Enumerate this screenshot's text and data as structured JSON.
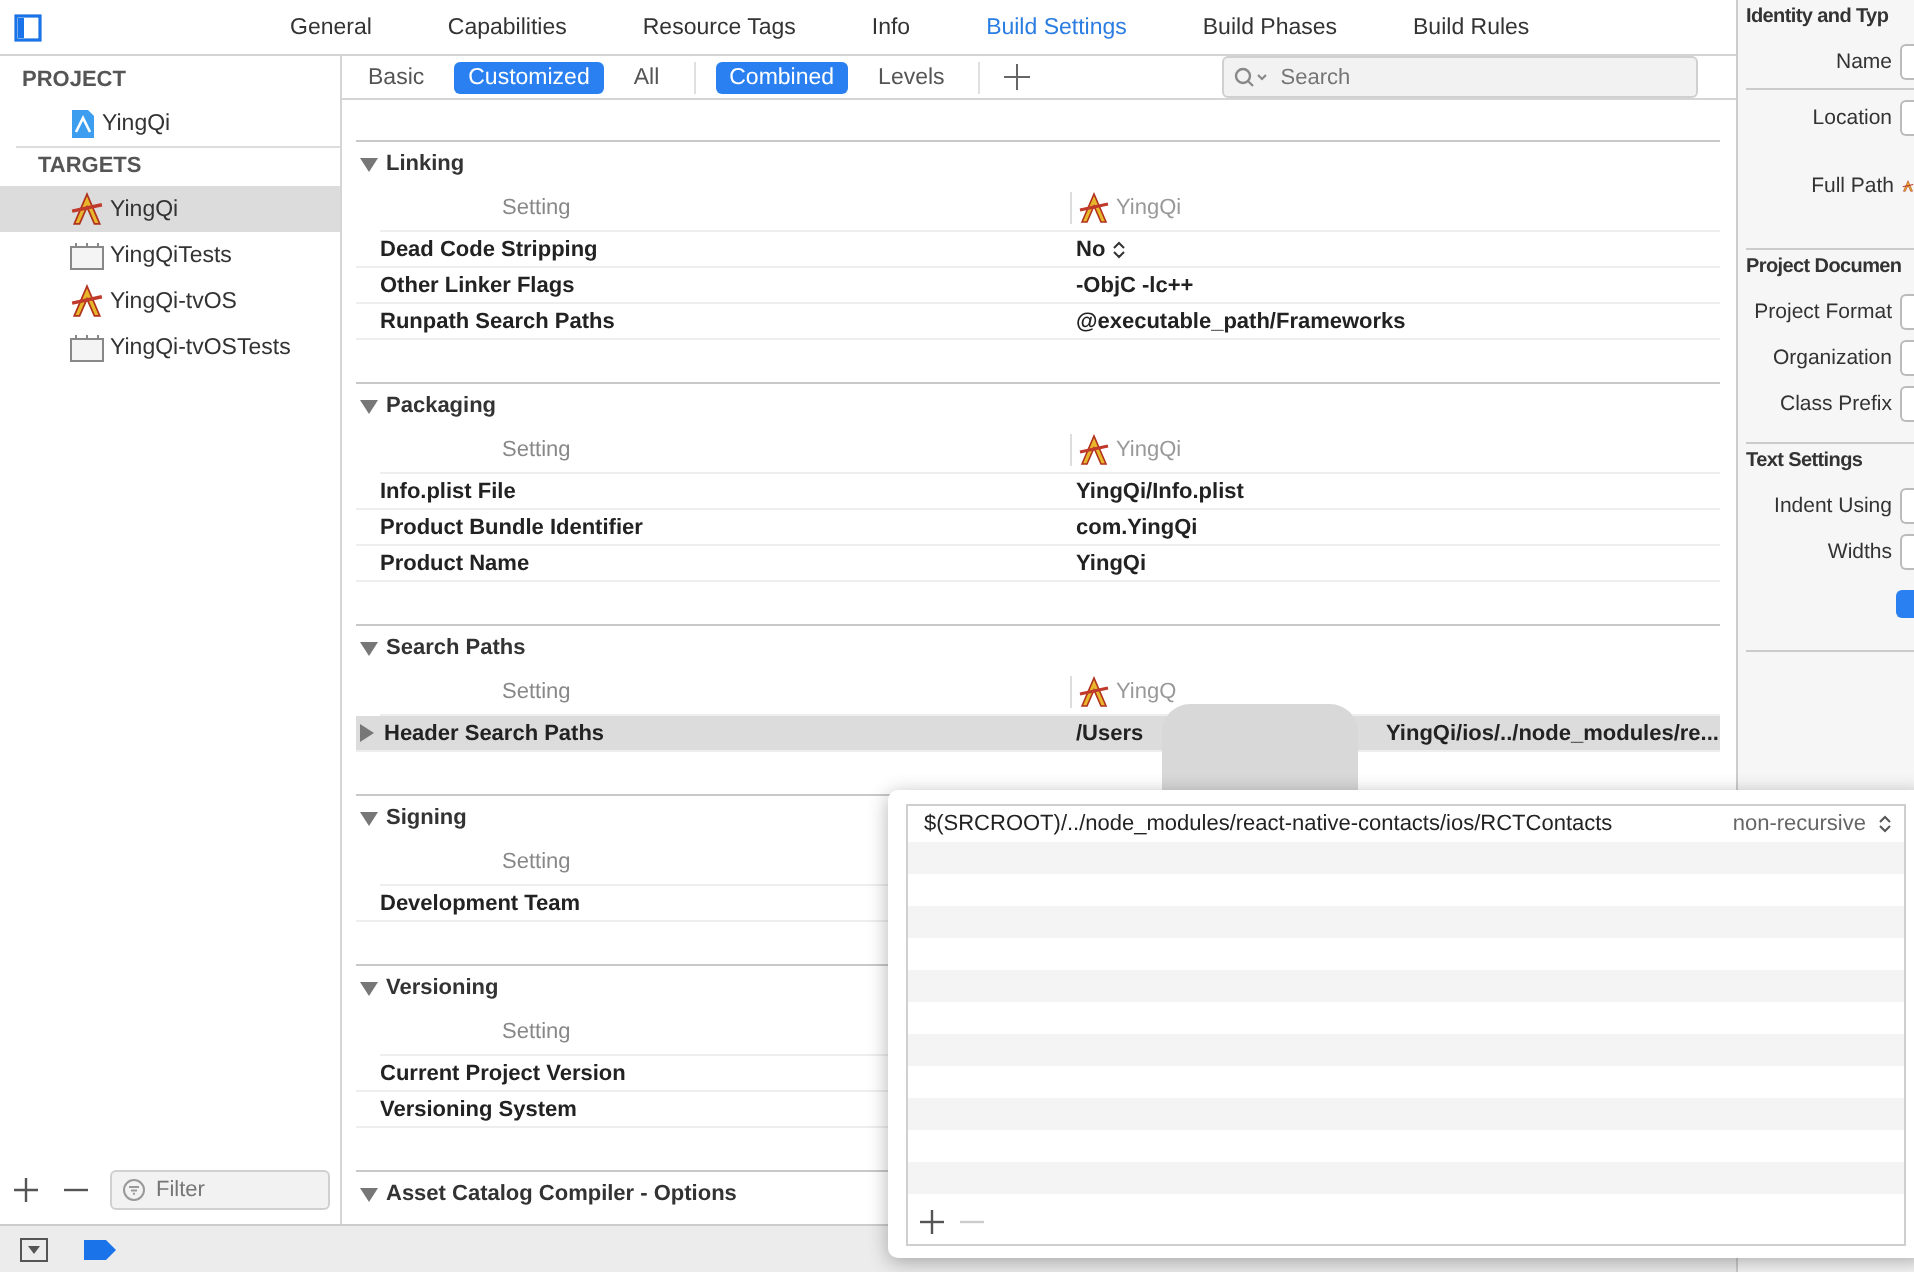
{
  "toolbar": {
    "tabs": [
      {
        "label": "General",
        "selected": false
      },
      {
        "label": "Capabilities",
        "selected": false
      },
      {
        "label": "Resource Tags",
        "selected": false
      },
      {
        "label": "Info",
        "selected": false
      },
      {
        "label": "Build Settings",
        "selected": true
      },
      {
        "label": "Build Phases",
        "selected": false
      },
      {
        "label": "Build Rules",
        "selected": false
      }
    ]
  },
  "sidebar": {
    "groups": [
      {
        "title": "PROJECT",
        "items": [
          {
            "label": "YingQi",
            "kind": "project",
            "selected": false
          }
        ]
      },
      {
        "title": "TARGETS",
        "items": [
          {
            "label": "YingQi",
            "kind": "app",
            "selected": true
          },
          {
            "label": "YingQiTests",
            "kind": "bundle",
            "selected": false
          },
          {
            "label": "YingQi-tvOS",
            "kind": "app",
            "selected": false
          },
          {
            "label": "YingQi-tvOSTests",
            "kind": "bundle",
            "selected": false
          }
        ]
      }
    ],
    "filter": {
      "placeholder": "Filter"
    }
  },
  "scope_bar": {
    "filters": [
      {
        "label": "Basic",
        "selected": false
      },
      {
        "label": "Customized",
        "selected": true
      },
      {
        "label": "All",
        "selected": false
      }
    ],
    "views": [
      {
        "label": "Combined",
        "selected": true
      },
      {
        "label": "Levels",
        "selected": false
      }
    ],
    "search": {
      "placeholder": "Search"
    }
  },
  "sections": [
    {
      "title": "Linking",
      "expanded": true,
      "column_label": "Setting",
      "target": "YingQi",
      "rows": [
        {
          "name": "Dead Code Stripping",
          "kind": "popup",
          "value": "No",
          "selected": false
        },
        {
          "name": "Other Linker Flags",
          "kind": "text",
          "value": "-ObjC -lc++",
          "selected": false
        },
        {
          "name": "Runpath Search Paths",
          "kind": "text",
          "value": "@executable_path/Frameworks",
          "selected": false
        }
      ]
    },
    {
      "title": "Packaging",
      "expanded": true,
      "column_label": "Setting",
      "target": "YingQi",
      "rows": [
        {
          "name": "Info.plist File",
          "kind": "text",
          "value": "YingQi/Info.plist",
          "selected": false
        },
        {
          "name": "Product Bundle Identifier",
          "kind": "text",
          "value": "com.YingQi",
          "selected": false
        },
        {
          "name": "Product Name",
          "kind": "text",
          "value": "YingQi",
          "selected": false
        }
      ]
    },
    {
      "title": "Search Paths",
      "expanded": true,
      "column_label": "Setting",
      "target": "YingQ",
      "rows": [
        {
          "name": "Header Search Paths",
          "kind": "list",
          "value": "/Users",
          "value_end": "YingQi/ios/../node_modules/re...",
          "selected": true
        }
      ]
    },
    {
      "title": "Signing",
      "expanded": true,
      "column_label": "Setting",
      "rows": [
        {
          "name": "Development Team",
          "kind": "text",
          "selected": false
        }
      ]
    },
    {
      "title": "Versioning",
      "expanded": true,
      "column_label": "Setting",
      "rows": [
        {
          "name": "Current Project Version",
          "kind": "text",
          "selected": false
        },
        {
          "name": "Versioning System",
          "kind": "text",
          "selected": false
        }
      ]
    },
    {
      "title": "Asset Catalog Compiler - Options",
      "expanded": true
    }
  ],
  "popover": {
    "rows": [
      {
        "path": "$(SRCROOT)/../node_modules/react-native-contacts/ios/RCTContacts",
        "mode": "non-recursive"
      }
    ],
    "buttons": [
      {
        "kind": "add",
        "disabled": false
      },
      {
        "kind": "remove",
        "disabled": true
      }
    ]
  },
  "inspector": {
    "groups": [
      {
        "title": "Identity and Typ",
        "fields": [
          "Name",
          "Location",
          "Full Path"
        ]
      },
      {
        "title": "Project Documen",
        "fields": [
          "Project Format",
          "Organization",
          "Class Prefix"
        ]
      },
      {
        "title": "Text Settings",
        "fields": [
          "Indent Using",
          "Widths"
        ],
        "checkbox": {
          "checked": true
        }
      }
    ]
  }
}
